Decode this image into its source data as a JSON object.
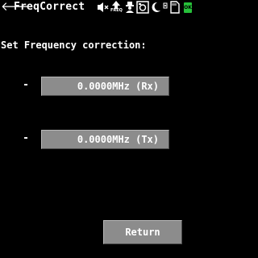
{
  "header": {
    "title": "FreqCorrect",
    "back_icon": "back-arrow-icon",
    "freq_tag": "FREQ",
    "battery_label": "OK"
  },
  "status_icons": [
    "speaker-muted-icon",
    "freq-icon",
    "person-icon",
    "camera-icon",
    "moon-icon",
    "sd-card-icon",
    "battery-icon"
  ],
  "main": {
    "heading": "Set Frequency correction:",
    "rx": {
      "minus_label": "-",
      "value": "0.0000MHz (Rx)"
    },
    "tx": {
      "minus_label": "-",
      "value": "0.0000MHz (Tx)"
    },
    "return_label": "Return"
  },
  "colors": {
    "background": "#000000",
    "text": "#ffffff",
    "button": "#8c8c8c",
    "battery": "#27c13a"
  }
}
